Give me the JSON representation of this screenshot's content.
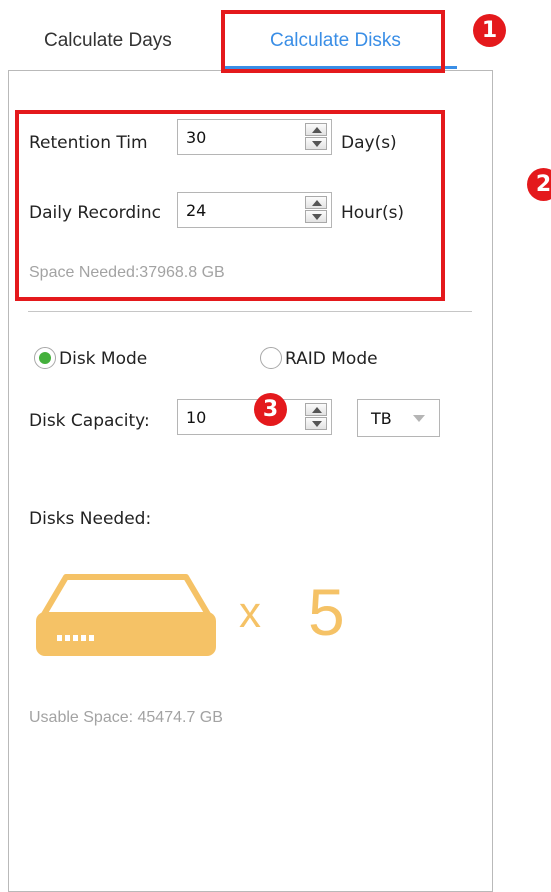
{
  "tabs": {
    "days": "Calculate Days",
    "disks": "Calculate Disks"
  },
  "inputs": {
    "retention": {
      "label": "Retention Tim",
      "value": "30",
      "unit": "Day(s)"
    },
    "daily": {
      "label": "Daily Recordinc",
      "value": "24",
      "unit": "Hour(s)"
    }
  },
  "space_needed": "Space Needed:37968.8 GB",
  "mode": {
    "disk": "Disk Mode",
    "raid": "RAID Mode",
    "selected": "disk"
  },
  "disk_capacity": {
    "label": "Disk Capacity:",
    "value": "10",
    "unit": "TB"
  },
  "disks_needed": {
    "label": "Disks Needed:",
    "x": "x",
    "count": "5"
  },
  "usable_space": "Usable Space: 45474.7 GB",
  "annotations": {
    "one": "1",
    "two": "2",
    "three": "3"
  },
  "colors": {
    "accent": "#3a8ee6",
    "annotation": "#e4191c",
    "disk": "#f5c266",
    "radio_selected": "#44b03c"
  }
}
